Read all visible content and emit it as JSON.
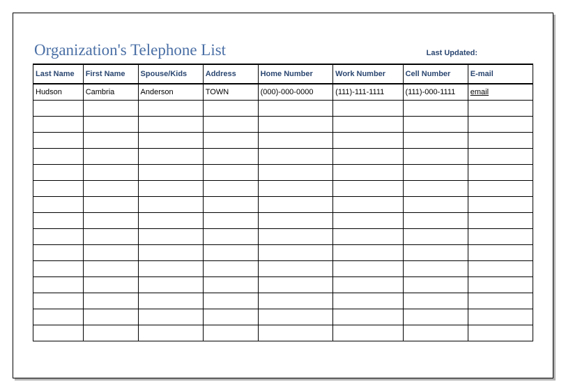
{
  "title": "Organization's Telephone List",
  "lastUpdatedLabel": "Last Updated:",
  "columns": {
    "lastName": "Last Name",
    "firstName": "First Name",
    "spouseKids": "Spouse/Kids",
    "address": "Address",
    "homeNumber": "Home Number",
    "workNumber": "Work Number",
    "cellNumber": "Cell Number",
    "email": "E-mail"
  },
  "rows": [
    {
      "lastName": "Hudson",
      "firstName": "Cambria",
      "spouseKids": "Anderson",
      "address": "TOWN",
      "homeNumber": "(000)-000-0000",
      "workNumber": "(111)-111-1111",
      "cellNumber": "(111)-000-1111",
      "email": "email"
    }
  ],
  "emptyRowCount": 15
}
